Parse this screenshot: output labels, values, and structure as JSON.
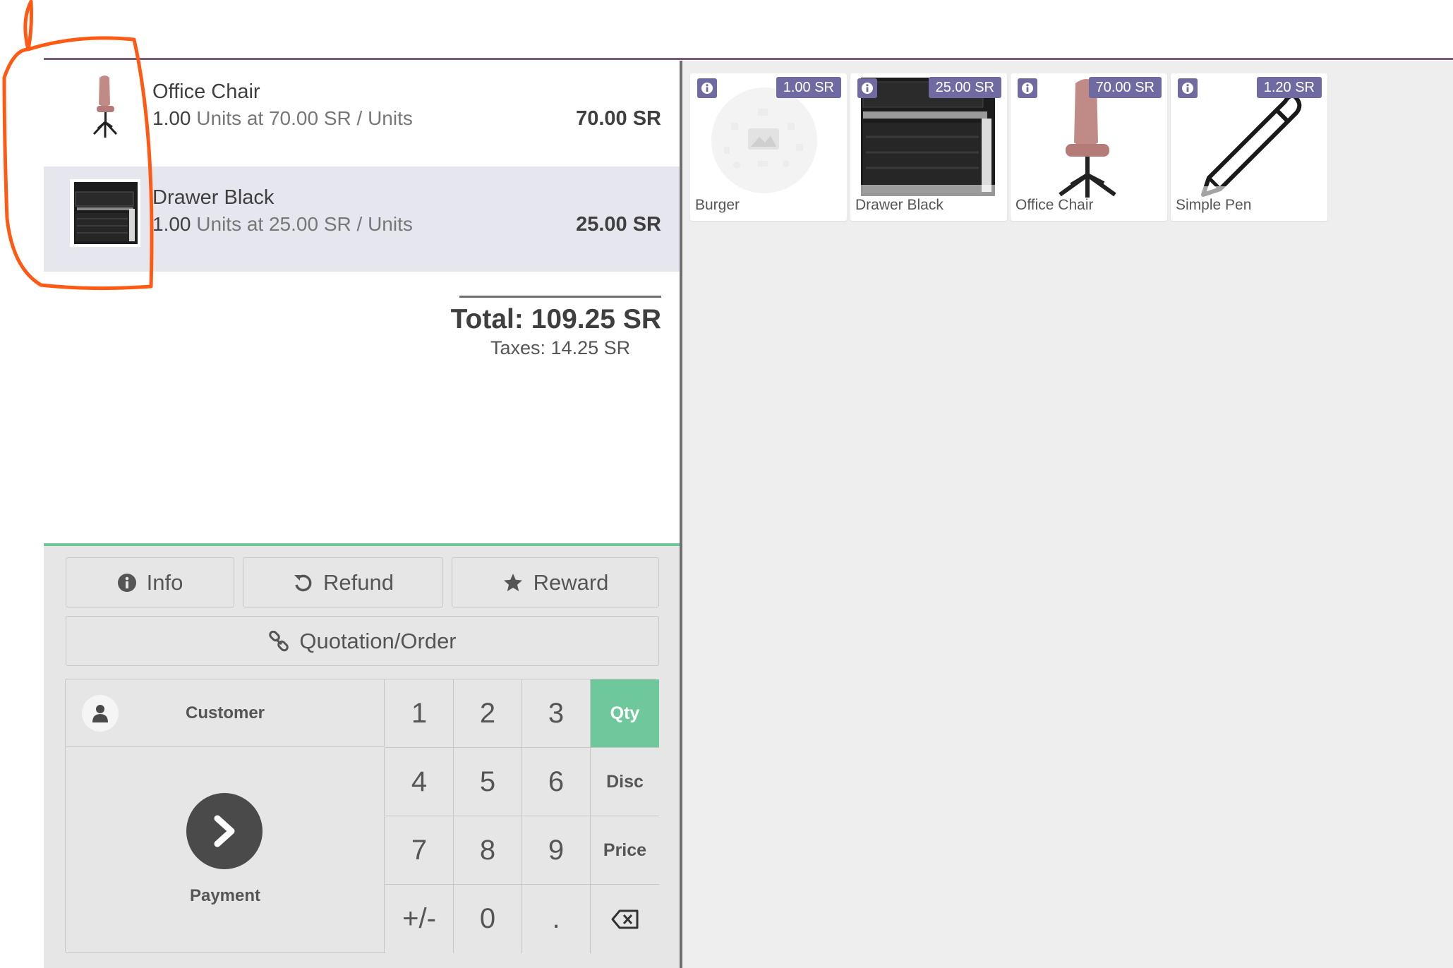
{
  "order": {
    "lines": [
      {
        "name": "Office Chair",
        "qty": "1.00",
        "unit_info": " Units at 70.00 SR / Units",
        "price": "70.00 SR",
        "image": "office-chair"
      },
      {
        "name": "Drawer Black",
        "qty": "1.00",
        "unit_info": " Units at 25.00 SR / Units",
        "price": "25.00 SR",
        "image": "drawer-black"
      }
    ],
    "total": "Total: 109.25 SR",
    "taxes": "Taxes: 14.25 SR"
  },
  "control_buttons": {
    "info": "Info",
    "refund": "Refund",
    "reward": "Reward",
    "quotation": "Quotation/Order"
  },
  "actionpad": {
    "customer": "Customer",
    "payment": "Payment"
  },
  "numpad": {
    "keys": [
      "1",
      "2",
      "3",
      "4",
      "5",
      "6",
      "7",
      "8",
      "9",
      "+/-",
      "0",
      "."
    ],
    "modes": {
      "qty": "Qty",
      "disc": "Disc",
      "price": "Price"
    },
    "active_mode": "Qty"
  },
  "products": [
    {
      "name": "Burger",
      "price": "1.00 SR",
      "image": "placeholder"
    },
    {
      "name": "Drawer Black",
      "price": "25.00 SR",
      "image": "drawer-black"
    },
    {
      "name": "Office Chair",
      "price": "70.00 SR",
      "image": "office-chair"
    },
    {
      "name": "Simple Pen",
      "price": "1.20 SR",
      "image": "pen"
    }
  ],
  "colors": {
    "accent_green": "#6ec89b",
    "price_badge": "#6f6aa1",
    "header_rule": "#7b5b7b",
    "annotation": "#ff5a14"
  }
}
